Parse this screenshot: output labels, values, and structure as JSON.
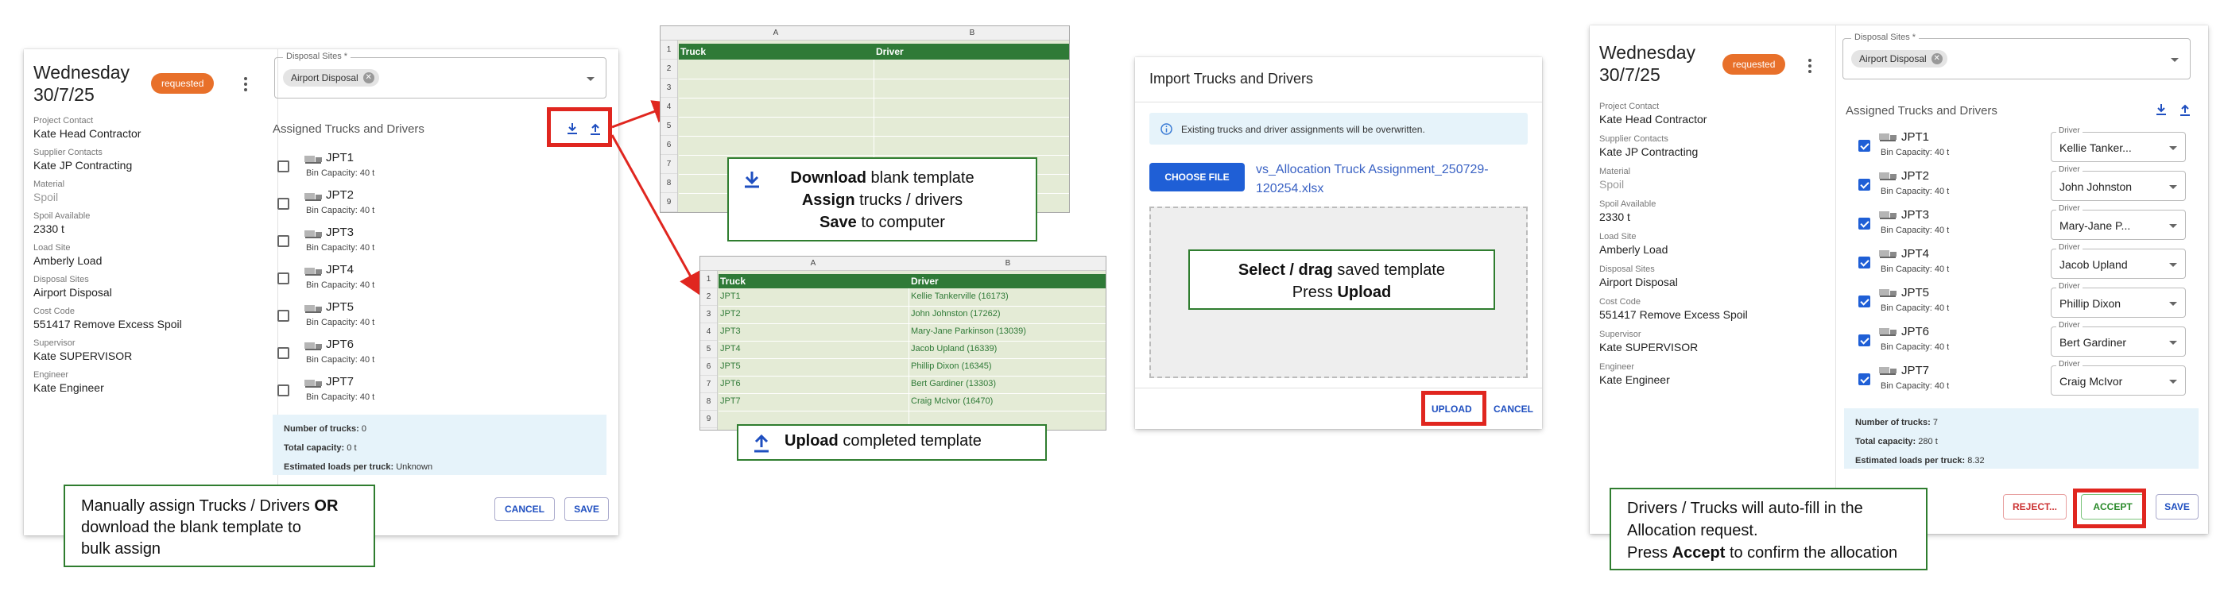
{
  "left_panel": {
    "day": "Wednesday",
    "date": "30/7/25",
    "status": "requested",
    "fields": [
      {
        "label": "Project Contact",
        "value": "Kate Head Contractor"
      },
      {
        "label": "Supplier Contacts",
        "value": "Kate JP Contracting"
      },
      {
        "label": "Material",
        "value": "Spoil"
      },
      {
        "label": "Spoil Available",
        "value": "2330 t"
      },
      {
        "label": "Load Site",
        "value": "Amberly Load"
      },
      {
        "label": "Disposal Sites",
        "value": "Airport Disposal"
      },
      {
        "label": "Cost Code",
        "value": "551417 Remove Excess Spoil"
      },
      {
        "label": "Supervisor",
        "value": "Kate SUPERVISOR"
      },
      {
        "label": "Engineer",
        "value": "Kate Engineer"
      }
    ]
  },
  "form1": {
    "disposal_label": "Disposal Sites *",
    "disposal_chip": "Airport Disposal",
    "section_title": "Assigned Trucks and Drivers",
    "trucks": [
      {
        "name": "JPT1",
        "cap": "Bin Capacity: 40 t"
      },
      {
        "name": "JPT2",
        "cap": "Bin Capacity: 40 t"
      },
      {
        "name": "JPT3",
        "cap": "Bin Capacity: 40 t"
      },
      {
        "name": "JPT4",
        "cap": "Bin Capacity: 40 t"
      },
      {
        "name": "JPT5",
        "cap": "Bin Capacity: 40 t"
      },
      {
        "name": "JPT6",
        "cap": "Bin Capacity: 40 t"
      },
      {
        "name": "JPT7",
        "cap": "Bin Capacity: 40 t"
      }
    ],
    "summary": {
      "trucks_label": "Number of trucks:",
      "trucks_val": "0",
      "capacity_label": "Total capacity:",
      "capacity_val": "0 t",
      "loads_label": "Estimated loads per truck:",
      "loads_val": "Unknown"
    },
    "cancel": "CANCEL",
    "save": "SAVE"
  },
  "callout1": {
    "line1_pre": "Manually assign Trucks / Drivers ",
    "line1_bold": "OR",
    "line2": "download the blank template to",
    "line3": "bulk assign"
  },
  "sheet_blank": {
    "col_a": "A",
    "col_b": "B",
    "h_truck": "Truck",
    "h_driver": "Driver",
    "rows": [
      "1",
      "2",
      "3",
      "4",
      "5",
      "6",
      "7",
      "8",
      "9"
    ]
  },
  "callout2": {
    "l1_bold": "Download",
    "l1_rest": " blank template",
    "l2_bold": "Assign",
    "l2_rest": " trucks / drivers",
    "l3_bold": "Save",
    "l3_rest": " to computer"
  },
  "sheet_filled": {
    "col_a": "A",
    "col_b": "B",
    "h_truck": "Truck",
    "h_driver": "Driver",
    "rows": [
      "1",
      "2",
      "3",
      "4",
      "5",
      "6",
      "7",
      "8",
      "9"
    ],
    "data": [
      {
        "t": "JPT1",
        "d": "Kellie Tankerville (16173)"
      },
      {
        "t": "JPT2",
        "d": "John Johnston (17262)"
      },
      {
        "t": "JPT3",
        "d": "Mary-Jane Parkinson (13039)"
      },
      {
        "t": "JPT4",
        "d": "Jacob Upland (16339)"
      },
      {
        "t": "JPT5",
        "d": "Phillip Dixon (16345)"
      },
      {
        "t": "JPT6",
        "d": "Bert Gardiner (13303)"
      },
      {
        "t": "JPT7",
        "d": "Craig McIvor (16470)"
      }
    ]
  },
  "callout3": {
    "bold": "Upload",
    "rest": " completed template"
  },
  "import_dialog": {
    "title": "Import Trucks and Drivers",
    "info": "Existing trucks and driver assignments will be overwritten.",
    "choose_file": "CHOOSE FILE",
    "file_name_1": "vs_Allocation Truck Assignment_250729-",
    "file_name_2": "120254.xlsx",
    "upload": "UPLOAD",
    "cancel": "CANCEL"
  },
  "callout4": {
    "l1_bold": "Select / drag",
    "l1_rest": " saved template",
    "l2_pre": "Press ",
    "l2_bold": "Upload"
  },
  "right_panel": {
    "day": "Wednesday",
    "date": "30/7/25",
    "status": "requested",
    "fields": [
      {
        "label": "Project Contact",
        "value": "Kate Head Contractor"
      },
      {
        "label": "Supplier Contacts",
        "value": "Kate JP Contracting"
      },
      {
        "label": "Material",
        "value": "Spoil"
      },
      {
        "label": "Spoil Available",
        "value": "2330 t"
      },
      {
        "label": "Load Site",
        "value": "Amberly Load"
      },
      {
        "label": "Disposal Sites",
        "value": "Airport Disposal"
      },
      {
        "label": "Cost Code",
        "value": "551417 Remove Excess Spoil"
      },
      {
        "label": "Supervisor",
        "value": "Kate SUPERVISOR"
      },
      {
        "label": "Engineer",
        "value": "Kate Engineer"
      }
    ]
  },
  "form2": {
    "disposal_label": "Disposal Sites *",
    "disposal_chip": "Airport Disposal",
    "section_title": "Assigned Trucks and Drivers",
    "driver_label": "Driver",
    "trucks": [
      {
        "name": "JPT1",
        "cap": "Bin Capacity: 40 t",
        "driver": "Kellie Tanker..."
      },
      {
        "name": "JPT2",
        "cap": "Bin Capacity: 40 t",
        "driver": "John Johnston"
      },
      {
        "name": "JPT3",
        "cap": "Bin Capacity: 40 t",
        "driver": "Mary-Jane P..."
      },
      {
        "name": "JPT4",
        "cap": "Bin Capacity: 40 t",
        "driver": "Jacob Upland"
      },
      {
        "name": "JPT5",
        "cap": "Bin Capacity: 40 t",
        "driver": "Phillip Dixon"
      },
      {
        "name": "JPT6",
        "cap": "Bin Capacity: 40 t",
        "driver": "Bert Gardiner"
      },
      {
        "name": "JPT7",
        "cap": "Bin Capacity: 40 t",
        "driver": "Craig McIvor"
      }
    ],
    "summary": {
      "trucks_label": "Number of trucks:",
      "trucks_val": "7",
      "capacity_label": "Total capacity:",
      "capacity_val": "280 t",
      "loads_label": "Estimated loads per truck:",
      "loads_val": "8.32"
    },
    "reject": "REJECT...",
    "accept": "ACCEPT",
    "save": "SAVE"
  },
  "callout5": {
    "line1": "Drivers / Trucks will auto-fill in the",
    "line2": "Allocation request.",
    "line3_pre": "Press ",
    "line3_bold": "Accept",
    "line3_rest": " to confirm the allocation"
  },
  "colors": {
    "accent": "#1f5fd6",
    "badge": "#e8702a",
    "highlight": "#e0261f",
    "sheet_header": "#2f7a37",
    "callout_border": "#2f7d2f"
  }
}
